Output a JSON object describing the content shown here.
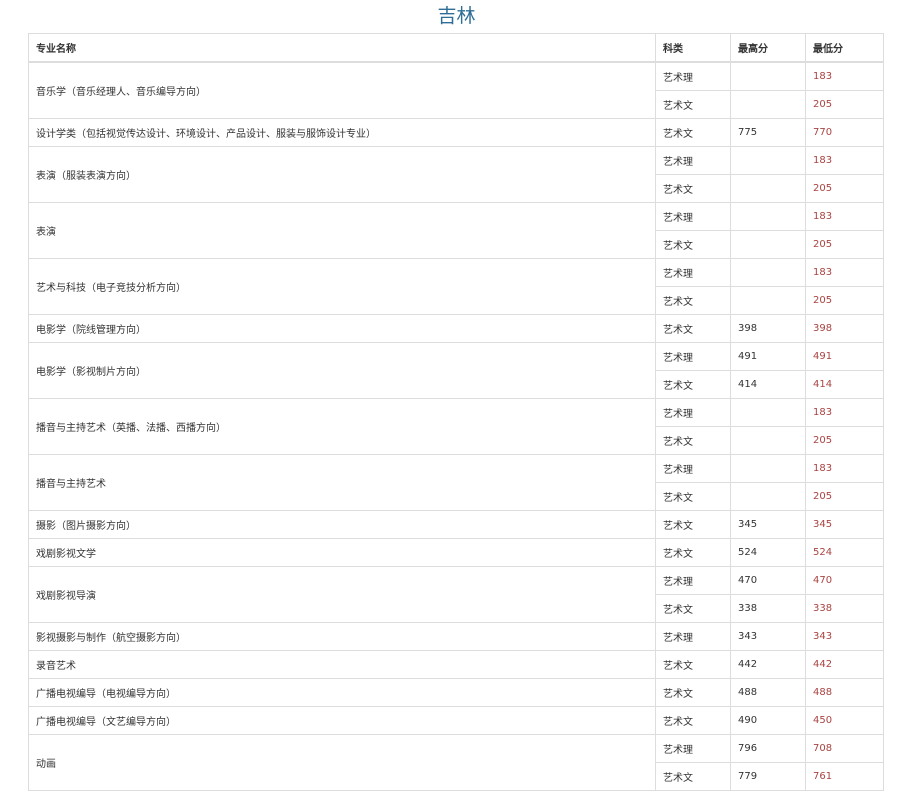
{
  "page": {
    "title": "吉林"
  },
  "table": {
    "headers": {
      "major": "专业名称",
      "category": "科类",
      "max": "最高分",
      "min": "最低分"
    },
    "rows": [
      {
        "major": "音乐学（音乐经理人、音乐编导方向）",
        "category": "艺术理",
        "max": "",
        "min": "183"
      },
      {
        "major": "",
        "category": "艺术文",
        "max": "",
        "min": "205"
      },
      {
        "major": "设计学类（包括视觉传达设计、环境设计、产品设计、服装与服饰设计专业）",
        "category": "艺术文",
        "max": "775",
        "min": "770"
      },
      {
        "major": "表演（服装表演方向）",
        "category": "艺术理",
        "max": "",
        "min": "183"
      },
      {
        "major": "",
        "category": "艺术文",
        "max": "",
        "min": "205"
      },
      {
        "major": "表演",
        "category": "艺术理",
        "max": "",
        "min": "183"
      },
      {
        "major": "",
        "category": "艺术文",
        "max": "",
        "min": "205"
      },
      {
        "major": "艺术与科技（电子竞技分析方向）",
        "category": "艺术理",
        "max": "",
        "min": "183"
      },
      {
        "major": "",
        "category": "艺术文",
        "max": "",
        "min": "205"
      },
      {
        "major": "电影学（院线管理方向）",
        "category": "艺术文",
        "max": "398",
        "min": "398"
      },
      {
        "major": "电影学（影视制片方向）",
        "category": "艺术理",
        "max": "491",
        "min": "491"
      },
      {
        "major": "",
        "category": "艺术文",
        "max": "414",
        "min": "414"
      },
      {
        "major": "播音与主持艺术（英播、法播、西播方向）",
        "category": "艺术理",
        "max": "",
        "min": "183"
      },
      {
        "major": "",
        "category": "艺术文",
        "max": "",
        "min": "205"
      },
      {
        "major": "播音与主持艺术",
        "category": "艺术理",
        "max": "",
        "min": "183"
      },
      {
        "major": "",
        "category": "艺术文",
        "max": "",
        "min": "205"
      },
      {
        "major": "摄影（图片摄影方向）",
        "category": "艺术文",
        "max": "345",
        "min": "345"
      },
      {
        "major": "戏剧影视文学",
        "category": "艺术文",
        "max": "524",
        "min": "524"
      },
      {
        "major": "戏剧影视导演",
        "category": "艺术理",
        "max": "470",
        "min": "470"
      },
      {
        "major": "",
        "category": "艺术文",
        "max": "338",
        "min": "338"
      },
      {
        "major": "影视摄影与制作（航空摄影方向）",
        "category": "艺术理",
        "max": "343",
        "min": "343"
      },
      {
        "major": "录音艺术",
        "category": "艺术文",
        "max": "442",
        "min": "442"
      },
      {
        "major": "广播电视编导（电视编导方向）",
        "category": "艺术文",
        "max": "488",
        "min": "488"
      },
      {
        "major": "广播电视编导（文艺编导方向）",
        "category": "艺术文",
        "max": "490",
        "min": "450"
      },
      {
        "major": "动画",
        "category": "艺术理",
        "max": "796",
        "min": "708"
      },
      {
        "major": "",
        "category": "艺术文",
        "max": "779",
        "min": "761"
      }
    ]
  },
  "colors": {
    "title": "#2e6d96",
    "min_score": "#a94442",
    "border": "#dddddd",
    "text": "#333333"
  }
}
